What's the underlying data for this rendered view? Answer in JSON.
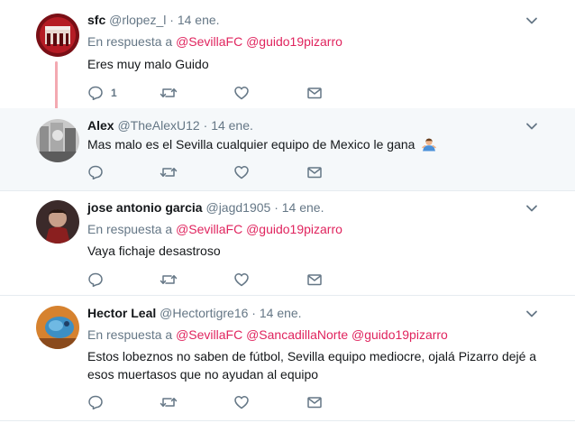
{
  "tweets": [
    {
      "name": "sfc",
      "handle": "@rlopez_l",
      "dot": "·",
      "time": "14 ene.",
      "reply_prefix": "En respuesta a",
      "mentions": [
        "@SevillaFC",
        "@guido19pizarro"
      ],
      "text": "Eres muy malo Guido",
      "reply_count": "1"
    },
    {
      "name": "Alex",
      "handle": "@TheAlexU12",
      "dot": "·",
      "time": "14 ene.",
      "text": "Mas malo es el Sevilla cualquier equipo de Mexico le gana",
      "emoji": "person-shrugging-emoji"
    },
    {
      "name": "jose antonio garcia",
      "handle": "@jagd1905",
      "dot": "·",
      "time": "14 ene.",
      "reply_prefix": "En respuesta a",
      "mentions": [
        "@SevillaFC",
        "@guido19pizarro"
      ],
      "text": "Vaya fichaje desastroso"
    },
    {
      "name": "Hector Leal",
      "handle": "@Hectortigre16",
      "dot": "·",
      "time": "14 ene.",
      "reply_prefix": "En respuesta a",
      "mentions": [
        "@SevillaFC",
        "@SancadillaNorte",
        "@guido19pizarro"
      ],
      "text_lines": [
        "Estos lobeznos no saben de fútbol, Sevilla equipo mediocre, ojalá Pizarro dejé a",
        "esos muertasos que no ayudan al equipo"
      ]
    }
  ],
  "icons": {
    "reply": "reply-icon",
    "retweet": "retweet-icon",
    "like": "heart-icon",
    "dm": "envelope-icon",
    "more": "chevron-down-icon"
  },
  "colors": {
    "mention": "#e0245e",
    "muted": "#657786",
    "thread_line": "#f3a9b1",
    "highlight_bg": "#f5f8fa"
  }
}
